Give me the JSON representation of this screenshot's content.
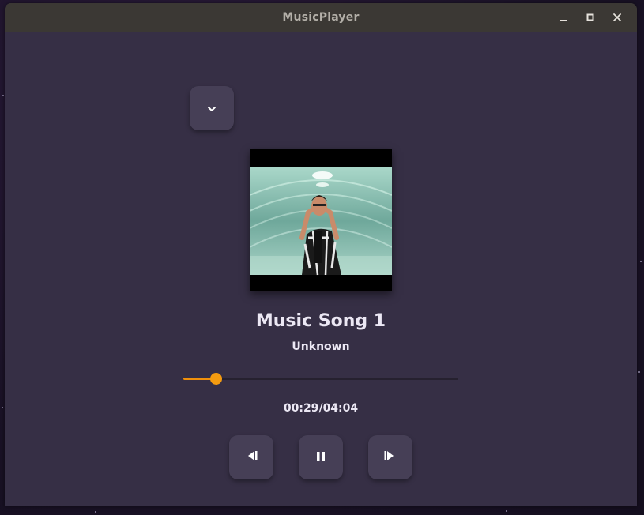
{
  "window": {
    "title": "MusicPlayer"
  },
  "player": {
    "song_title": "Music Song 1",
    "artist": "Unknown",
    "time": {
      "current": "00:29",
      "separator": "/",
      "total": "04:04"
    },
    "progress_fraction": 0.119
  },
  "icons": {
    "collapse": "chevron-down-icon",
    "previous": "skip-previous-icon",
    "pause": "pause-icon",
    "next": "skip-next-icon",
    "minimize": "minimize-icon",
    "maximize": "maximize-icon",
    "close": "close-icon"
  },
  "colors": {
    "accent": "#f49b10",
    "window_bg": "#362f45",
    "button_bg": "#463f56",
    "titlebar_bg": "#3b3834",
    "text": "#ece8f4"
  }
}
